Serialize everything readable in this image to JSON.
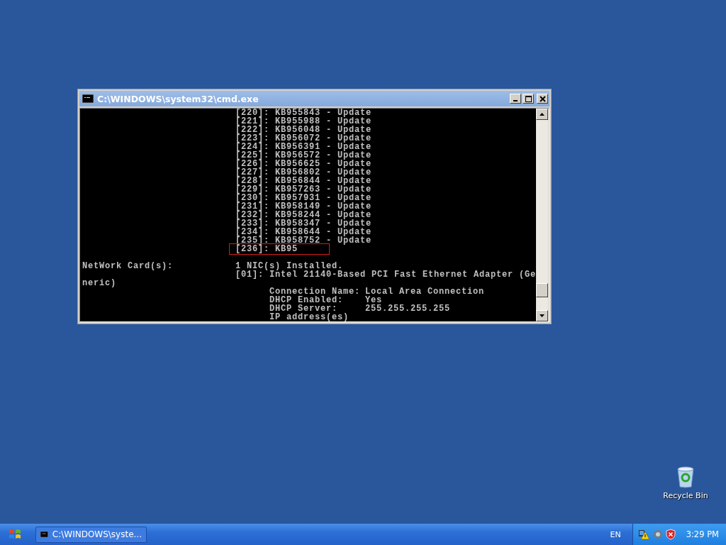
{
  "window": {
    "title": "C:\\WINDOWS\\system32\\cmd.exe"
  },
  "console": {
    "hotfixes": [
      {
        "text": "[220]: KB955843 - Update",
        "highlighted": false
      },
      {
        "text": "[221]: KB955988 - Update",
        "highlighted": false
      },
      {
        "text": "[222]: KB956048 - Update",
        "highlighted": false
      },
      {
        "text": "[223]: KB956072 - Update",
        "highlighted": false
      },
      {
        "text": "[224]: KB956391 - Update",
        "highlighted": false
      },
      {
        "text": "[225]: KB956572 - Update",
        "highlighted": false
      },
      {
        "text": "[226]: KB956625 - Update",
        "highlighted": false
      },
      {
        "text": "[227]: KB956802 - Update",
        "highlighted": false
      },
      {
        "text": "[228]: KB956844 - Update",
        "highlighted": false
      },
      {
        "text": "[229]: KB957263 - Update",
        "highlighted": false
      },
      {
        "text": "[230]: KB957931 - Update",
        "highlighted": false
      },
      {
        "text": "[231]: KB958149 - Update",
        "highlighted": false
      },
      {
        "text": "[232]: KB958244 - Update",
        "highlighted": false
      },
      {
        "text": "[233]: KB958347 - Update",
        "highlighted": false
      },
      {
        "text": "[234]: KB958644 - Update",
        "highlighted": false
      },
      {
        "text": "[235]: KB958752 - Update",
        "highlighted": false
      },
      {
        "text": "[236]: KB95",
        "highlighted": true
      }
    ],
    "network_label": "NetWork Card(s):",
    "nic_count": "1 NIC(s) Installed.",
    "adapter": "[01]: Intel 21140-Based PCI Fast Ethernet Adapter (Ge",
    "adapter_wrap": "neric)",
    "connection": [
      {
        "label": "Connection Name:",
        "value": "Local Area Connection"
      },
      {
        "label": "DHCP Enabled:",
        "value": "Yes"
      },
      {
        "label": "DHCP Server:",
        "value": "255.255.255.255"
      },
      {
        "label": "IP address(es)"
      }
    ]
  },
  "desktop_icons": [
    {
      "label": "Recycle Bin"
    }
  ],
  "taskbar": {
    "tasks": [
      {
        "label": "C:\\WINDOWS\\syste..."
      }
    ],
    "language": "EN",
    "clock": "3:29 PM"
  }
}
